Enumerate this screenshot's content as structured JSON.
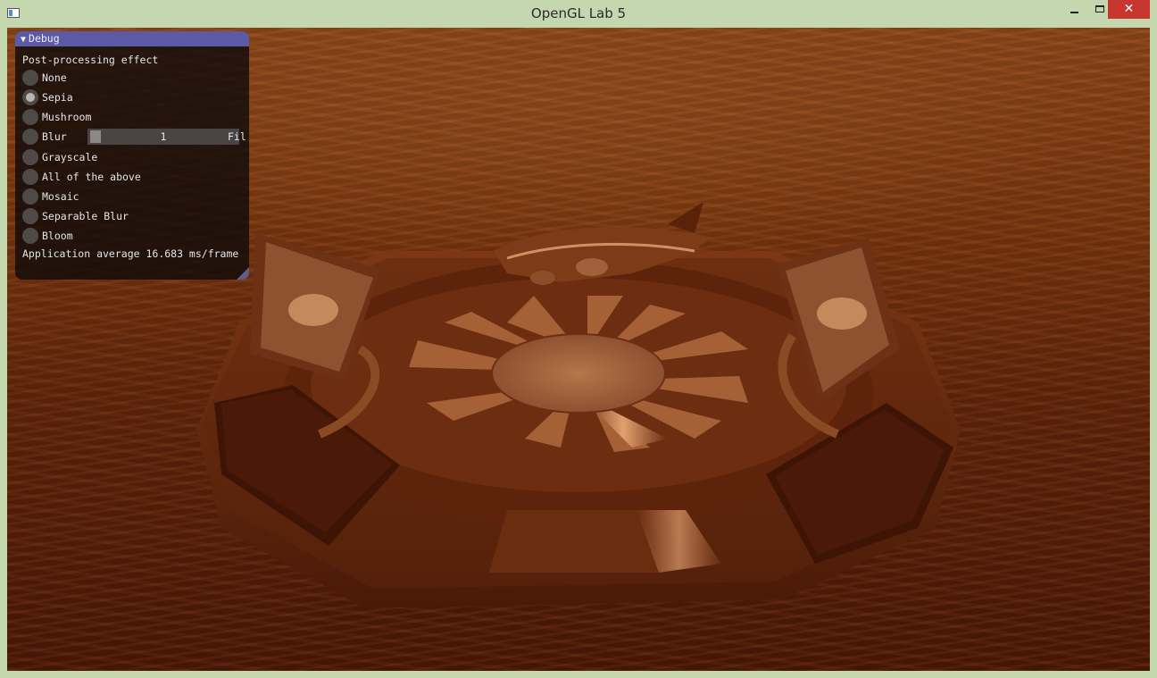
{
  "window": {
    "title": "OpenGL Lab 5",
    "minimize_glyph": "",
    "close_glyph": "✕"
  },
  "debug": {
    "header": "Debug",
    "section_label": "Post-processing effect",
    "options": [
      {
        "label": "None",
        "selected": false
      },
      {
        "label": "Sepia",
        "selected": true
      },
      {
        "label": "Mushroom",
        "selected": false
      },
      {
        "label": "Blur",
        "selected": false
      },
      {
        "label": "Grayscale",
        "selected": false
      },
      {
        "label": "All of the above",
        "selected": false
      },
      {
        "label": "Mosaic",
        "selected": false
      },
      {
        "label": "Separable Blur",
        "selected": false
      },
      {
        "label": "Bloom",
        "selected": false
      }
    ],
    "blur_slider_value": "1",
    "blur_trailing_text": "Fil",
    "stats": "Application average 16.683 ms/frame"
  },
  "colors": {
    "title_bar": "#c4d7ae",
    "debug_header": "#5c5aa6",
    "close_button": "#c7372f"
  }
}
